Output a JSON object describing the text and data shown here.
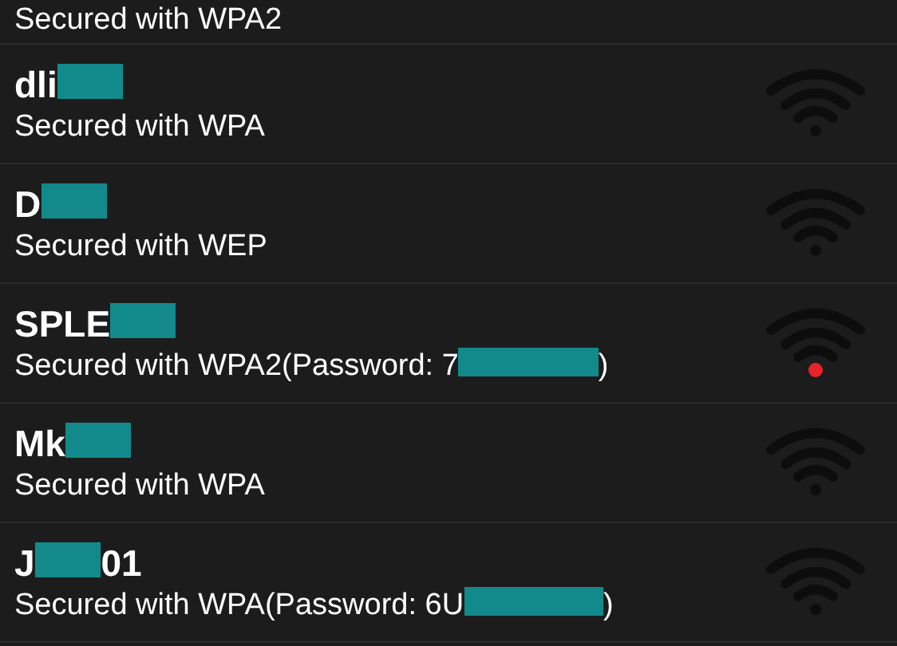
{
  "networks": [
    {
      "security": [
        {
          "kind": "text",
          "text": "Secured with WPA2"
        }
      ]
    },
    {
      "name": [
        {
          "kind": "text",
          "text": "dli"
        },
        {
          "kind": "redacted"
        }
      ],
      "security": [
        {
          "kind": "text",
          "text": "Secured with WPA"
        }
      ],
      "saved": false
    },
    {
      "name": [
        {
          "kind": "text",
          "text": "D"
        },
        {
          "kind": "redacted"
        }
      ],
      "security": [
        {
          "kind": "text",
          "text": "Secured with WEP"
        }
      ],
      "saved": false
    },
    {
      "name": [
        {
          "kind": "text",
          "text": "SPLE"
        },
        {
          "kind": "redacted"
        }
      ],
      "security": [
        {
          "kind": "text",
          "text": "Secured with WPA2(Password: 7"
        },
        {
          "kind": "redacted"
        },
        {
          "kind": "text",
          "text": ")"
        }
      ],
      "saved": true
    },
    {
      "name": [
        {
          "kind": "text",
          "text": "Mk"
        },
        {
          "kind": "redacted"
        }
      ],
      "security": [
        {
          "kind": "text",
          "text": "Secured with WPA"
        }
      ],
      "saved": false
    },
    {
      "name": [
        {
          "kind": "text",
          "text": "J"
        },
        {
          "kind": "redacted"
        },
        {
          "kind": "text",
          "text": "01"
        }
      ],
      "security": [
        {
          "kind": "text",
          "text": "Secured with WPA(Password: 6U"
        },
        {
          "kind": "redacted"
        },
        {
          "kind": "text",
          "text": ")"
        }
      ],
      "saved": false
    }
  ]
}
